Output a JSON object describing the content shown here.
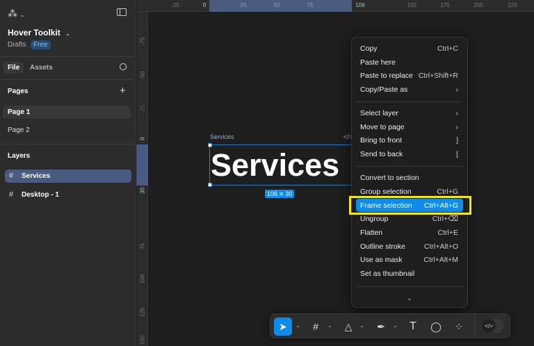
{
  "sidebar": {
    "project_title": "Hover Toolkit",
    "drafts": "Drafts",
    "plan_badge": "Free",
    "tabs": [
      {
        "label": "File"
      },
      {
        "label": "Assets"
      }
    ],
    "pages_heading": "Pages",
    "pages": [
      {
        "label": "Page 1"
      },
      {
        "label": "Page 2"
      }
    ],
    "layers_heading": "Layers",
    "layers": [
      {
        "label": "Services"
      },
      {
        "label": "Desktop - 1"
      }
    ]
  },
  "ruler_top": [
    "-25",
    "0",
    "25",
    "50",
    "75",
    "106",
    "150",
    "175",
    "200",
    "225"
  ],
  "ruler_left": [
    "-75",
    "-50",
    "-25",
    "0",
    "30",
    "75",
    "100",
    "125",
    "150"
  ],
  "canvas": {
    "frame_label": "Services",
    "frame_code_hint": "</>",
    "text": "Services",
    "size_w": "106",
    "size_h": "30"
  },
  "menu": {
    "items": [
      {
        "label": "Copy",
        "shortcut": "Ctrl+C"
      },
      {
        "label": "Paste here",
        "shortcut": ""
      },
      {
        "label": "Paste to replace",
        "shortcut": "Ctrl+Shift+R"
      },
      {
        "label": "Copy/Paste as",
        "shortcut": "›"
      },
      {
        "label": "Select layer",
        "shortcut": "›"
      },
      {
        "label": "Move to page",
        "shortcut": "›"
      },
      {
        "label": "Bring to front",
        "shortcut": "]"
      },
      {
        "label": "Send to back",
        "shortcut": "["
      },
      {
        "label": "Convert to section",
        "shortcut": ""
      },
      {
        "label": "Group selection",
        "shortcut": "Ctrl+G"
      },
      {
        "label": "Frame selection",
        "shortcut": "Ctrl+Alt+G"
      },
      {
        "label": "Ungroup",
        "shortcut": "Ctrl+⌫"
      },
      {
        "label": "Flatten",
        "shortcut": "Ctrl+E"
      },
      {
        "label": "Outline stroke",
        "shortcut": "Ctrl+Alt+O"
      },
      {
        "label": "Use as mask",
        "shortcut": "Ctrl+Alt+M"
      },
      {
        "label": "Set as thumbnail",
        "shortcut": ""
      }
    ],
    "more": "⌄"
  },
  "toolbar": {
    "code_toggle": "</>"
  },
  "colors": {
    "accent": "#0d8ce9",
    "highlight_box": "#f5e614",
    "selection": "#4a5a80"
  }
}
